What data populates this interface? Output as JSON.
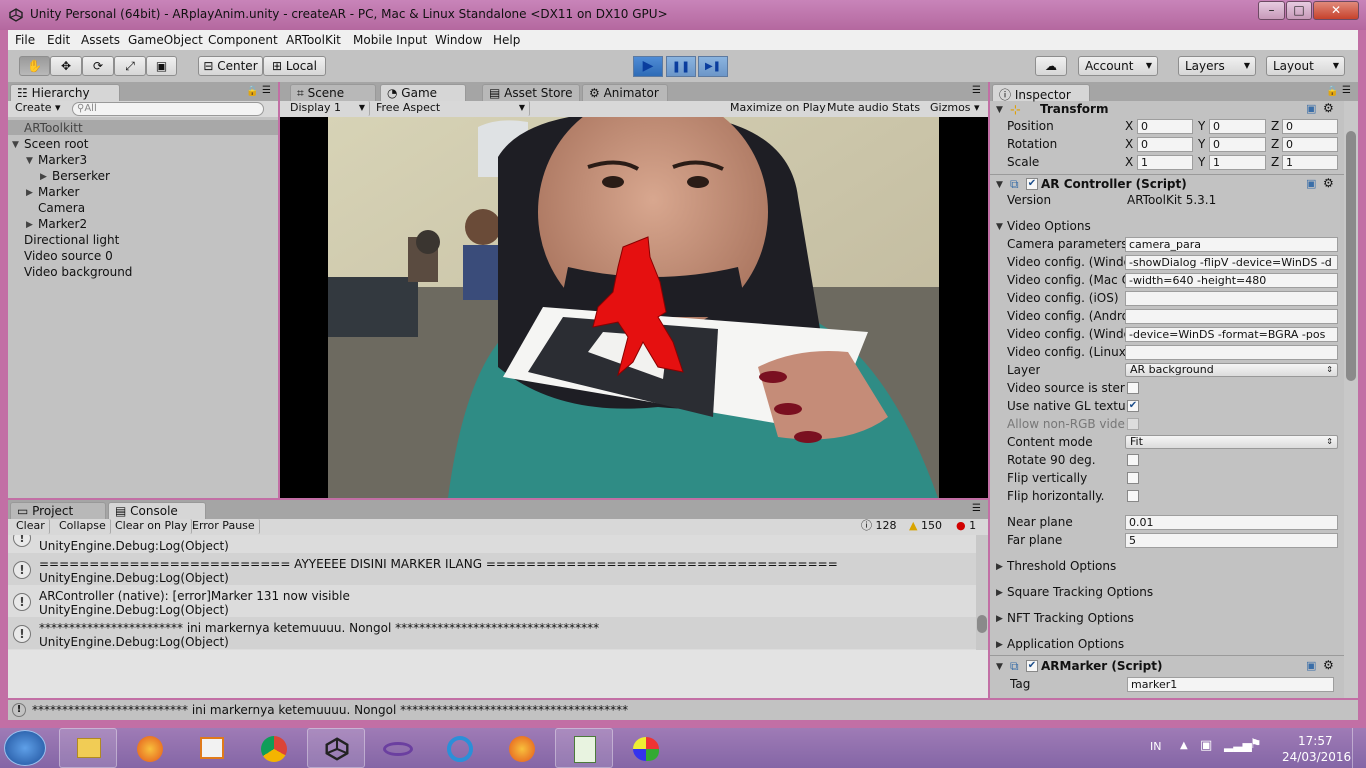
{
  "window": {
    "title": "Unity Personal (64bit) - ARplayAnim.unity - createAR - PC, Mac & Linux Standalone <DX11 on DX10 GPU>",
    "controls": {
      "minimize": "–",
      "maximize": "□",
      "close": "✕"
    }
  },
  "menu": [
    "File",
    "Edit",
    "Assets",
    "GameObject",
    "Component",
    "ARToolKit",
    "Mobile Input",
    "Window",
    "Help"
  ],
  "toolbar": {
    "tools": [
      "hand-icon",
      "move-icon",
      "rotate-icon",
      "scale-icon",
      "rect-icon"
    ],
    "pivot": "Center",
    "space": "Local",
    "play": "▶",
    "pause": "❚❚",
    "step": "▶❚",
    "cloud": "☁",
    "account": "Account",
    "layers": "Layers",
    "layout": "Layout"
  },
  "hierarchy": {
    "tab": "Hierarchy",
    "create": "Create",
    "search_placeholder": "All",
    "items": [
      {
        "label": "ARToolkitt"
      },
      {
        "label": "Sceen root"
      },
      {
        "label": "Marker3"
      },
      {
        "label": "Berserker"
      },
      {
        "label": "Marker"
      },
      {
        "label": "Camera"
      },
      {
        "label": "Marker2"
      },
      {
        "label": "Directional light"
      },
      {
        "label": "Video source 0"
      },
      {
        "label": "Video background"
      }
    ]
  },
  "game": {
    "tabs": [
      "Scene",
      "Game",
      "Asset Store",
      "Animator"
    ],
    "display": "Display 1",
    "aspect": "Free Aspect",
    "options": [
      "Maximize on Play",
      "Mute audio",
      "Stats",
      "Gizmos"
    ]
  },
  "console": {
    "tabs": [
      "Project",
      "Console"
    ],
    "buttons": [
      "Clear",
      "Collapse",
      "Clear on Play",
      "Error Pause"
    ],
    "counts": {
      "log": "128",
      "warn": "150",
      "error": "1"
    },
    "rows": [
      {
        "line1": "",
        "line2": "UnityEngine.Debug:Log(Object)"
      },
      {
        "line1": "========================= AYYEEEE DISINI MARKER ILANG ===================================",
        "line2": "UnityEngine.Debug:Log(Object)"
      },
      {
        "line1": "ARController (native): [error]Marker 131 now visible",
        "line2": "UnityEngine.Debug:Log(Object)"
      },
      {
        "line1": " ************************ ini markernya ketemuuuu. Nongol **********************************",
        "line2": "UnityEngine.Debug:Log(Object)"
      }
    ]
  },
  "status_bar": "************************** ini markernya ketemuuuu. Nongol **************************************",
  "inspector": {
    "tab": "Inspector",
    "transform": {
      "title": "Transform",
      "rows": [
        {
          "label": "Position",
          "x": "0",
          "y": "0",
          "z": "0"
        },
        {
          "label": "Rotation",
          "x": "0",
          "y": "0",
          "z": "0"
        },
        {
          "label": "Scale",
          "x": "1",
          "y": "1",
          "z": "1"
        }
      ],
      "axis": [
        "X",
        "Y",
        "Z"
      ]
    },
    "ar_controller": {
      "title": "AR Controller (Script)",
      "version_label": "Version",
      "version": "ARToolKit 5.3.1",
      "video_options": "Video Options",
      "fields": [
        {
          "label": "Camera parameters",
          "value": "camera_para"
        },
        {
          "label": "Video config. (Windo",
          "value": "-showDialog -flipV -device=WinDS -d"
        },
        {
          "label": "Video config. (Mac O",
          "value": "-width=640 -height=480"
        },
        {
          "label": "Video config. (iOS)",
          "value": ""
        },
        {
          "label": "Video config. (Andro",
          "value": ""
        },
        {
          "label": "Video config. (Windo",
          "value": "-device=WinDS -format=BGRA -pos"
        },
        {
          "label": "Video config. (Linux)",
          "value": ""
        }
      ],
      "layer_label": "Layer",
      "layer_value": "AR background",
      "checks": [
        {
          "label": "Video source is stere",
          "checked": false
        },
        {
          "label": "Use native GL textur",
          "checked": true
        },
        {
          "label": "Allow non-RGB videc",
          "checked": false
        }
      ],
      "content_mode_label": "Content mode",
      "content_mode_value": "Fit",
      "checks2": [
        {
          "label": "Rotate 90 deg.",
          "checked": false
        },
        {
          "label": "Flip vertically",
          "checked": false
        },
        {
          "label": "Flip horizontally.",
          "checked": false
        }
      ],
      "near_label": "Near plane",
      "near_value": "0.01",
      "far_label": "Far plane",
      "far_value": "5",
      "sections": [
        "Threshold Options",
        "Square Tracking Options",
        "NFT Tracking Options",
        "Application Options"
      ]
    },
    "ar_marker": {
      "title": "ARMarker (Script)",
      "tag_label": "Tag",
      "tag_value": "marker1"
    }
  },
  "taskbar": {
    "lang": "IN",
    "time": "17:57",
    "date": "24/03/2016",
    "apps": [
      "start-orb-icon",
      "file-explorer-icon",
      "firefox-icon",
      "media-player-icon",
      "chrome-icon",
      "unity-icon",
      "visual-studio-icon",
      "ie-icon",
      "firefox-icon",
      "notepad-icon",
      "paint-icon"
    ]
  }
}
